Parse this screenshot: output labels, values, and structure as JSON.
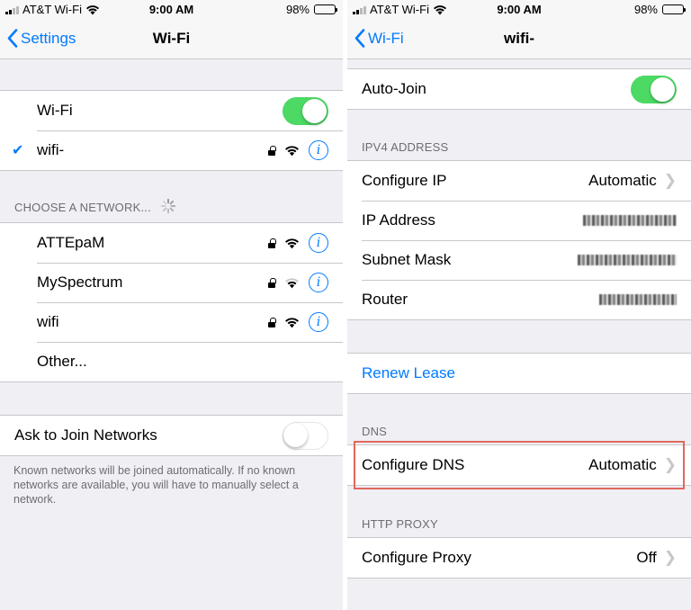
{
  "status": {
    "carrier": "AT&T Wi-Fi",
    "time": "9:00 AM",
    "battery": "98%"
  },
  "left": {
    "back_label": "Settings",
    "title": "Wi-Fi",
    "wifi_label": "Wi-Fi",
    "connected_network": "wifi-",
    "choose_header": "CHOOSE A NETWORK...",
    "networks": [
      {
        "name": "ATTEpaM",
        "signal": "strong"
      },
      {
        "name": "MySpectrum",
        "signal": "weak"
      },
      {
        "name": "wifi",
        "signal": "strong"
      }
    ],
    "other_label": "Other...",
    "ask_join_label": "Ask to Join Networks",
    "ask_join_note": "Known networks will be joined automatically. If no known networks are available, you will have to manually select a network."
  },
  "right": {
    "back_label": "Wi-Fi",
    "title": "wifi-",
    "auto_join_label": "Auto-Join",
    "ipv4_header": "IPV4 ADDRESS",
    "configure_ip_label": "Configure IP",
    "configure_ip_value": "Automatic",
    "ip_address_label": "IP Address",
    "subnet_mask_label": "Subnet Mask",
    "router_label": "Router",
    "renew_lease_label": "Renew Lease",
    "dns_header": "DNS",
    "configure_dns_label": "Configure DNS",
    "configure_dns_value": "Automatic",
    "http_proxy_header": "HTTP PROXY",
    "configure_proxy_label": "Configure Proxy",
    "configure_proxy_value": "Off"
  },
  "colors": {
    "accent": "#007aff",
    "toggle_on": "#4cd964",
    "highlight": "#e0685b"
  }
}
